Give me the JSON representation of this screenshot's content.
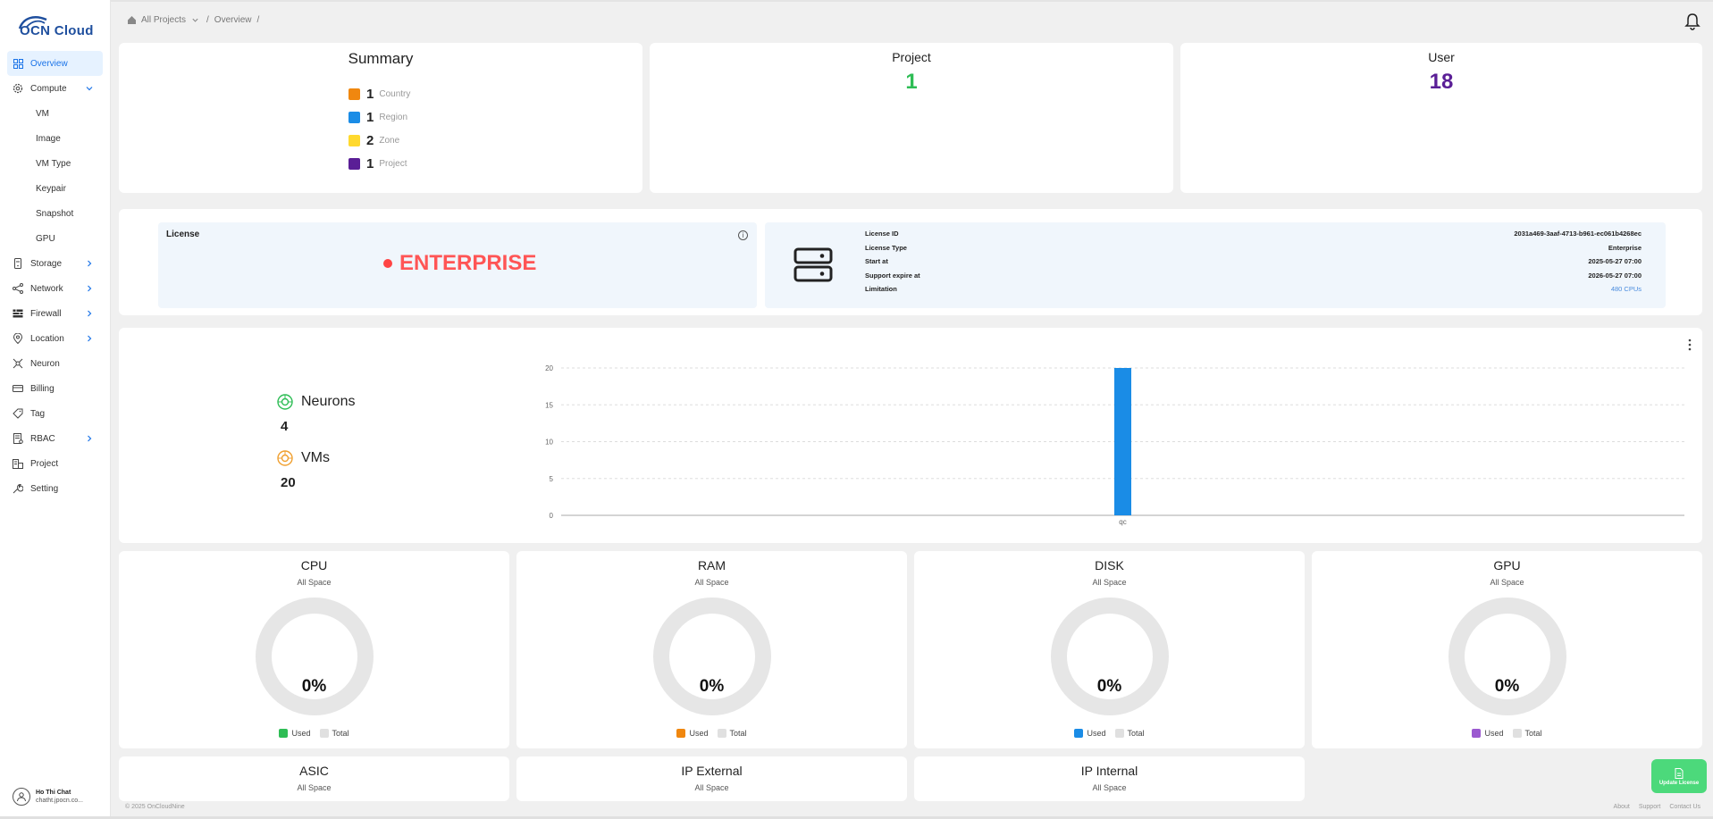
{
  "app": {
    "logo_text": "OCN Cloud"
  },
  "breadcrumb": {
    "home": "All Projects",
    "current": "Overview"
  },
  "sidebar": {
    "items": [
      {
        "label": "Overview",
        "icon": "grid-icon"
      },
      {
        "label": "Compute",
        "icon": "gear-icon"
      },
      {
        "label": "Storage",
        "icon": "storage-icon"
      },
      {
        "label": "Network",
        "icon": "network-icon"
      },
      {
        "label": "Firewall",
        "icon": "firewall-icon"
      },
      {
        "label": "Location",
        "icon": "location-icon"
      },
      {
        "label": "Neuron",
        "icon": "neuron-icon"
      },
      {
        "label": "Billing",
        "icon": "billing-icon"
      },
      {
        "label": "Tag",
        "icon": "tag-icon"
      },
      {
        "label": "RBAC",
        "icon": "rbac-icon"
      },
      {
        "label": "Project",
        "icon": "building-icon"
      },
      {
        "label": "Setting",
        "icon": "wrench-icon"
      }
    ],
    "compute_sub": [
      "VM",
      "Image",
      "VM Type",
      "Keypair",
      "Snapshot",
      "GPU"
    ]
  },
  "user": {
    "name": "Ho Thi Chat",
    "email": "chatht.jpocn.co..."
  },
  "summary": {
    "title": "Summary",
    "rows": [
      {
        "num": "1",
        "label": "Country",
        "color": "#f0870f"
      },
      {
        "num": "1",
        "label": "Region",
        "color": "#1a8ce6"
      },
      {
        "num": "2",
        "label": "Zone",
        "color": "#ffd92e"
      },
      {
        "num": "1",
        "label": "Project",
        "color": "#5a1e96"
      }
    ]
  },
  "project": {
    "title": "Project",
    "value": "1",
    "color": "#2ebd55"
  },
  "user_card": {
    "title": "User",
    "value": "18",
    "color": "#5a1e96"
  },
  "license": {
    "label": "License",
    "edition": "ENTERPRISE",
    "fields": [
      {
        "k": "License ID",
        "v": "2031a469-3aaf-4713-b961-ec061b4268ec"
      },
      {
        "k": "License Type",
        "v": "Enterprise"
      },
      {
        "k": "Start at",
        "v": "2025-05-27 07:00"
      },
      {
        "k": "Support expire at",
        "v": "2026-05-27 07:00"
      },
      {
        "k": "Limitation",
        "v": "480 CPUs"
      }
    ]
  },
  "neurons": {
    "label": "Neurons",
    "value": "4",
    "vms_label": "VMs",
    "vms_value": "20"
  },
  "chart_data": {
    "type": "bar",
    "categories": [
      "qc"
    ],
    "values": [
      20
    ],
    "yticks": [
      0,
      5,
      10,
      15,
      20
    ],
    "ylim": [
      0,
      20
    ],
    "color": "#1a8ce6"
  },
  "resources": [
    {
      "title": "CPU",
      "sub": "All Space",
      "pct": "0%",
      "used_color": "#2ebd55"
    },
    {
      "title": "RAM",
      "sub": "All Space",
      "pct": "0%",
      "used_color": "#f0870f"
    },
    {
      "title": "DISK",
      "sub": "All Space",
      "pct": "0%",
      "used_color": "#1a8ce6"
    },
    {
      "title": "GPU",
      "sub": "All Space",
      "pct": "0%",
      "used_color": "#9b59d0"
    }
  ],
  "legend": {
    "used": "Used",
    "total": "Total"
  },
  "resources2": [
    {
      "title": "ASIC",
      "sub": "All Space"
    },
    {
      "title": "IP External",
      "sub": "All Space"
    },
    {
      "title": "IP Internal",
      "sub": "All Space"
    }
  ],
  "footer": {
    "copy": "© 2025 OnCloudNine",
    "links": [
      "About",
      "Support",
      "Contact Us"
    ]
  },
  "update_license": "Update License"
}
